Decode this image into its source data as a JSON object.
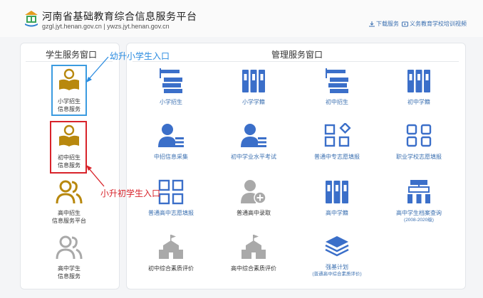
{
  "header": {
    "title": "河南省基础教育综合信息服务平台",
    "domains": "gzgl.jyt.henan.gov.cn | ywzs.jyt.henan.gov.cn",
    "download_link": "下载服务",
    "training_link": "义务教育学校培训视频"
  },
  "student_panel": {
    "title": "学生服务窗口",
    "items": [
      {
        "line1": "小学招生",
        "line2": "信息服务"
      },
      {
        "line1": "初中招生",
        "line2": "信息服务"
      },
      {
        "line1": "高中招生",
        "line2": "信息服务平台"
      },
      {
        "line1": "高中学生",
        "line2": "信息服务"
      }
    ]
  },
  "admin_panel": {
    "title": "管理服务窗口",
    "items": [
      {
        "label": "小学招生",
        "sub": ""
      },
      {
        "label": "小学学籍",
        "sub": ""
      },
      {
        "label": "初中招生",
        "sub": ""
      },
      {
        "label": "初中学籍",
        "sub": ""
      },
      {
        "label": "中招信息采集",
        "sub": ""
      },
      {
        "label": "初中学业水平考试",
        "sub": ""
      },
      {
        "label": "普通中专志愿填报",
        "sub": ""
      },
      {
        "label": "职业学校志愿填报",
        "sub": ""
      },
      {
        "label": "普通高中志愿填报",
        "sub": ""
      },
      {
        "label": "普通高中录取",
        "sub": ""
      },
      {
        "label": "高中学籍",
        "sub": ""
      },
      {
        "label": "高中学生档案查询",
        "sub": "(2008-2020级)"
      },
      {
        "label": "初中综合素质评价",
        "sub": ""
      },
      {
        "label": "高中综合素质评价",
        "sub": ""
      },
      {
        "label": "强基计划",
        "sub": "(普通高中综合素质评价)"
      }
    ]
  },
  "annotations": {
    "primary": "幼升小学生入口",
    "middle": "小升初学生入口"
  },
  "colors": {
    "accent_blue": "#3b6fc9",
    "gold": "#b8880e",
    "gray_icon": "#a9a9a9",
    "highlight_blue": "#3b9be0",
    "highlight_red": "#d8232a"
  }
}
